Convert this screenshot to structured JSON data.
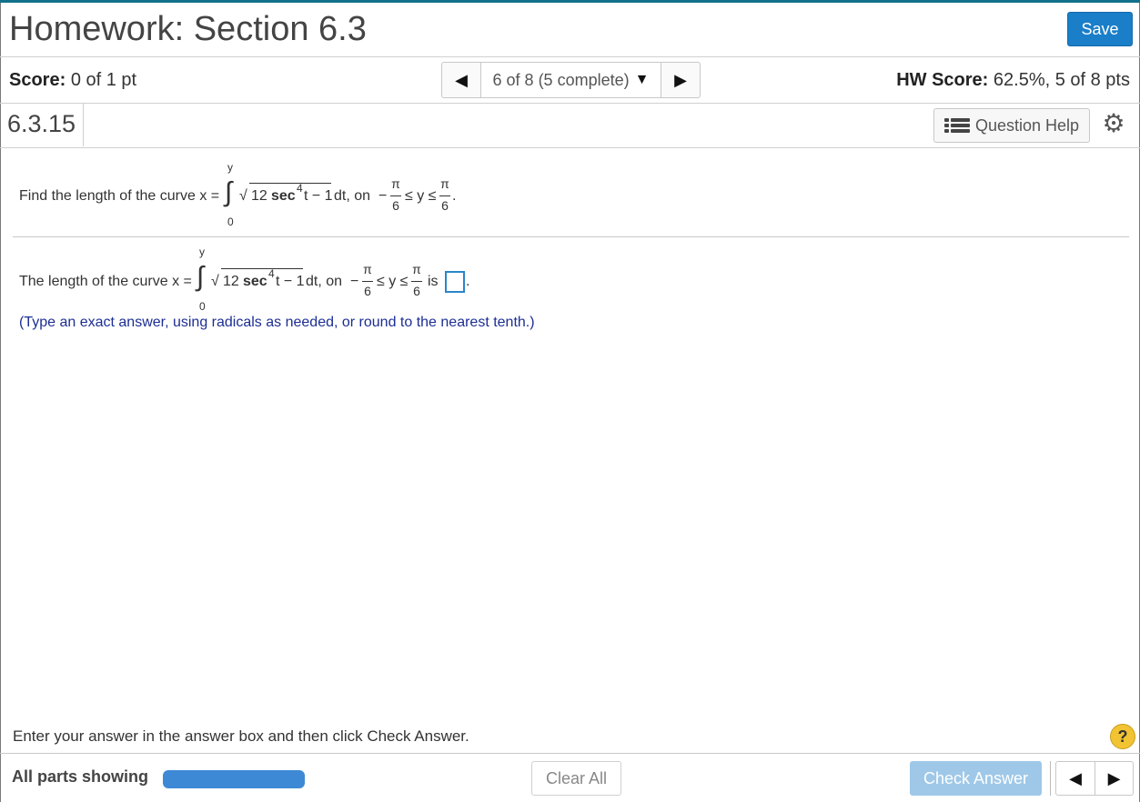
{
  "header": {
    "title": "Homework: Section 6.3",
    "save_label": "Save"
  },
  "scorebar": {
    "score_label": "Score:",
    "score_value": "0 of 1 pt",
    "nav_position": "6 of 8 (5 complete)",
    "hw_score_label": "HW Score:",
    "hw_score_value": "62.5%, 5 of 8 pts"
  },
  "question_bar": {
    "number": "6.3.15",
    "help_label": "Question Help"
  },
  "question": {
    "prompt_prefix": "Find the length of the curve x =",
    "answer_prefix": "The length of the curve x =",
    "integrand": "12",
    "sec": "sec",
    "exponent": "4",
    "integrand_tail": "t − 1",
    "dt_on": "dt, on",
    "minus": "−",
    "pi": "π",
    "six": "6",
    "leq_y_leq": "≤ y ≤",
    "period": ".",
    "is": "is",
    "upper_limit": "y",
    "lower_limit": "0",
    "hint": "(Type an exact answer, using radicals as needed, or round to the nearest tenth.)"
  },
  "instructions": "Enter your answer in the answer box and then click Check Answer.",
  "help_symbol": "?",
  "footer": {
    "all_parts": "All parts showing",
    "progress": 1.0,
    "clear_all": "Clear All",
    "check_answer": "Check Answer"
  },
  "icons": {
    "prev": "triangle-left",
    "next": "triangle-right",
    "dropdown": "triangle-down",
    "question_help": "list-icon",
    "settings": "gear-icon"
  },
  "colors": {
    "accent": "#1a7ec8",
    "hint": "#1c2e94",
    "check_answer_disabled": "#9fc8e8",
    "progress": "#3d89d6",
    "help": "#f2c332"
  }
}
